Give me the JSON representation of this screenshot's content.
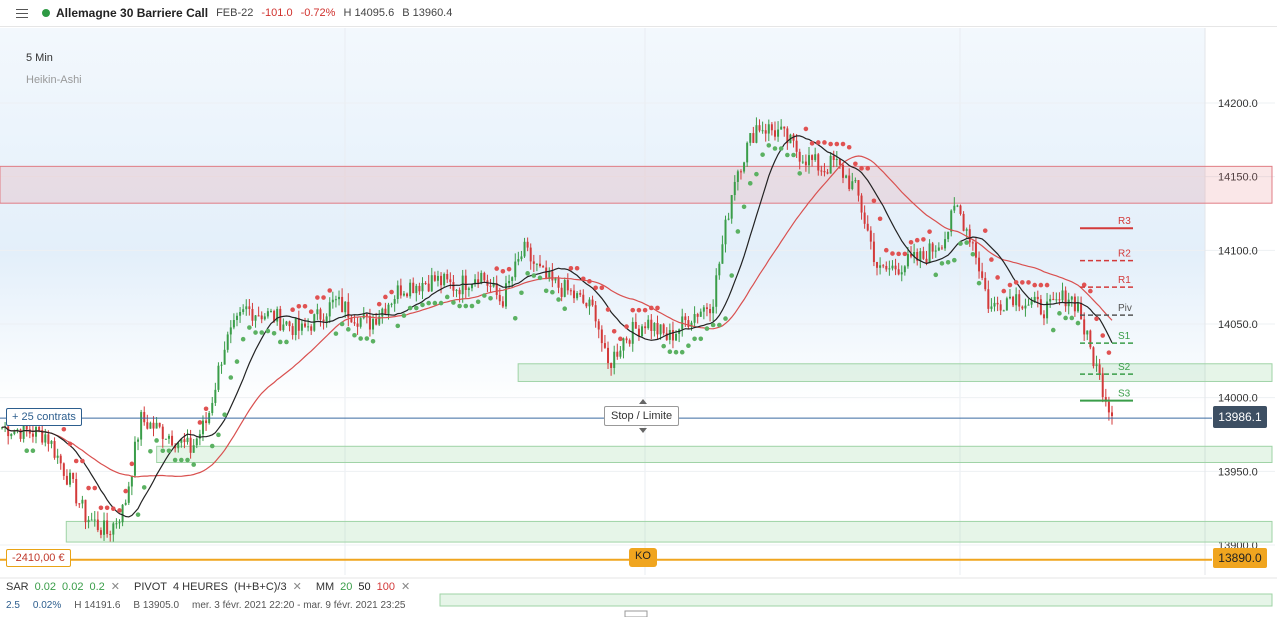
{
  "header": {
    "menu_icon": "hamburger-icon",
    "status_color": "#2e9a44",
    "instrument": "Allemagne 30 Barriere Call",
    "expiry": "FEB-22",
    "change": "-101.0",
    "change_pct": "-0.72%",
    "high": "H 14095.6",
    "low": "B 13960.4"
  },
  "chart_meta": {
    "timeframe": "5 Min",
    "chart_type": "Heikin-Ashi",
    "position_label": "+ 25 contrats",
    "pl_label": "-2410,00 €",
    "ko_label": "KO",
    "stop_label": "Stop / Limite",
    "current_price": "13986.1",
    "ko_price": "13890.0"
  },
  "indicators": {
    "sar_name": "SAR",
    "sar_p1": "0.02",
    "sar_p2": "0.02",
    "sar_p3": "0.2",
    "pivot_name": "PIVOT",
    "pivot_period": "4 HEURES",
    "pivot_formula": "(H+B+C)/3",
    "mm_name": "MM",
    "mm_p1": "20",
    "mm_p2": "50",
    "mm_p3": "100",
    "close_icon": "close-icon"
  },
  "stats": {
    "v1": "2.5",
    "v2": "0.02%",
    "high": "H 14191.6",
    "low": "B 13905.0",
    "range": "mer. 3 févr. 2021 22:20 - mar. 9 févr. 2021 23:25"
  },
  "colors": {
    "up": "#3a9d49",
    "down": "#d33a3a",
    "ma_black": "#222222",
    "ma_red": "#d9504f",
    "price_line": "#3a6aa0",
    "ko_line": "#f0a51f"
  },
  "chart_data": {
    "type": "candlestick",
    "ylim": [
      13880,
      14220
    ],
    "y_ticks": [
      "14200.0",
      "14150.0",
      "14100.0",
      "14050.0",
      "14000.0",
      "13950.0",
      "13900.0"
    ],
    "y_tick_values": [
      14200,
      14150,
      14100,
      14050,
      14000,
      13950,
      13900
    ],
    "pivots": [
      {
        "name": "R3",
        "value": 14115
      },
      {
        "name": "R2",
        "value": 14093
      },
      {
        "name": "R1",
        "value": 14075
      },
      {
        "name": "Piv",
        "value": 14056
      },
      {
        "name": "S1",
        "value": 14037
      },
      {
        "name": "S2",
        "value": 14016
      },
      {
        "name": "S3",
        "value": 13998
      }
    ],
    "zones": [
      {
        "kind": "resistance",
        "from": 14132,
        "to": 14157,
        "x0": 0.0,
        "x1": 1.0
      },
      {
        "kind": "support",
        "from": 14011,
        "to": 14023,
        "x0": 0.43,
        "x1": 1.0
      },
      {
        "kind": "support",
        "from": 13956,
        "to": 13967,
        "x0": 0.13,
        "x1": 1.0
      },
      {
        "kind": "support",
        "from": 13902,
        "to": 13916,
        "x0": 0.055,
        "x1": 1.0
      }
    ],
    "price_line": 13986.1,
    "ko_line": 13890.0,
    "path": [
      [
        0.0,
        13980
      ],
      [
        0.04,
        13975
      ],
      [
        0.06,
        13945
      ],
      [
        0.075,
        13920
      ],
      [
        0.095,
        13908
      ],
      [
        0.11,
        13925
      ],
      [
        0.125,
        13985
      ],
      [
        0.15,
        13975
      ],
      [
        0.17,
        13965
      ],
      [
        0.185,
        13985
      ],
      [
        0.2,
        14035
      ],
      [
        0.22,
        14060
      ],
      [
        0.245,
        14055
      ],
      [
        0.27,
        14045
      ],
      [
        0.3,
        14065
      ],
      [
        0.33,
        14050
      ],
      [
        0.36,
        14075
      ],
      [
        0.39,
        14080
      ],
      [
        0.41,
        14075
      ],
      [
        0.43,
        14085
      ],
      [
        0.45,
        14065
      ],
      [
        0.47,
        14100
      ],
      [
        0.49,
        14080
      ],
      [
        0.51,
        14072
      ],
      [
        0.535,
        14058
      ],
      [
        0.545,
        14020
      ],
      [
        0.56,
        14040
      ],
      [
        0.58,
        14052
      ],
      [
        0.6,
        14040
      ],
      [
        0.62,
        14055
      ],
      [
        0.64,
        14065
      ],
      [
        0.66,
        14150
      ],
      [
        0.68,
        14185
      ],
      [
        0.7,
        14180
      ],
      [
        0.72,
        14165
      ],
      [
        0.74,
        14155
      ],
      [
        0.75,
        14160
      ],
      [
        0.77,
        14140
      ],
      [
        0.79,
        14085
      ],
      [
        0.81,
        14090
      ],
      [
        0.83,
        14095
      ],
      [
        0.85,
        14110
      ],
      [
        0.86,
        14130
      ],
      [
        0.875,
        14105
      ],
      [
        0.89,
        14060
      ],
      [
        0.91,
        14070
      ],
      [
        0.93,
        14062
      ],
      [
        0.945,
        14060
      ],
      [
        0.96,
        14070
      ],
      [
        0.975,
        14058
      ],
      [
        0.995,
        14062
      ],
      [
        1.0,
        14065
      ]
    ],
    "tail": [
      [
        0.0,
        14060
      ],
      [
        0.06,
        14055
      ],
      [
        0.1,
        14040
      ],
      [
        0.14,
        14020
      ],
      [
        0.17,
        13965
      ],
      [
        0.19,
        13978
      ],
      [
        0.22,
        13986
      ]
    ]
  }
}
